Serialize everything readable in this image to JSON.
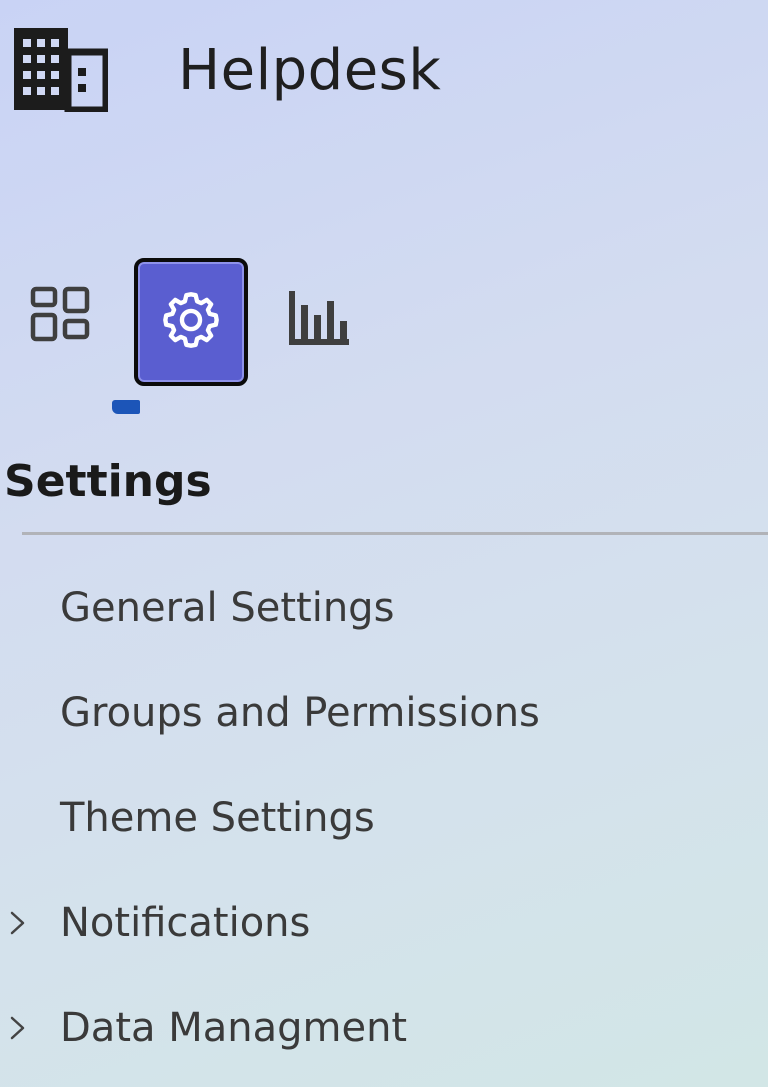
{
  "app": {
    "title": "Helpdesk",
    "logo_icon": "building-icon"
  },
  "nav": {
    "items": [
      {
        "name": "dashboard",
        "icon": "dashboard-grid-icon",
        "active": false
      },
      {
        "name": "settings",
        "icon": "gear-icon",
        "active": true
      },
      {
        "name": "reports",
        "icon": "bar-chart-icon",
        "active": false
      }
    ]
  },
  "settings": {
    "title": "Settings",
    "items": [
      {
        "label": "General Settings",
        "expandable": false
      },
      {
        "label": "Groups and Permissions",
        "expandable": false
      },
      {
        "label": "Theme Settings",
        "expandable": false
      },
      {
        "label": "Notifications",
        "expandable": true
      },
      {
        "label": "Data Managment",
        "expandable": true
      }
    ]
  },
  "colors": {
    "accent": "#5a5ed0",
    "indicator": "#1c55b8",
    "text": "#3a3a3a"
  }
}
